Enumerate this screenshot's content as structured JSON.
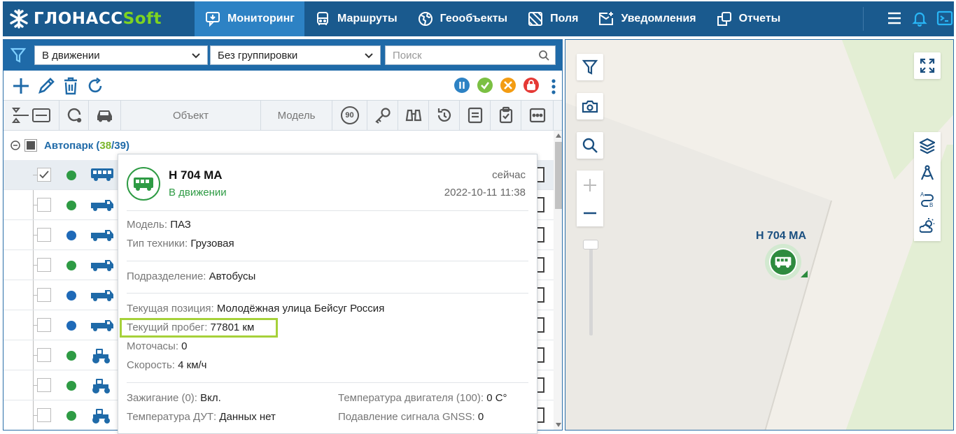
{
  "app": {
    "logo_main": "ГЛОНАСС",
    "logo_accent": "Soft",
    "brand_color": "#1a5a8e",
    "accent_color": "#7ed321"
  },
  "nav": {
    "items": [
      {
        "label": "Мониторинг",
        "icon": "monitor-chat-icon",
        "active": true
      },
      {
        "label": "Маршруты",
        "icon": "bus-front-icon"
      },
      {
        "label": "Геообъекты",
        "icon": "globe-icon"
      },
      {
        "label": "Поля",
        "icon": "field-icon"
      },
      {
        "label": "Уведомления",
        "icon": "mail-icon"
      },
      {
        "label": "Отчеты",
        "icon": "report-icon"
      }
    ],
    "right_icons": [
      "menu-icon",
      "bell-icon",
      "terminal-icon"
    ]
  },
  "filters": {
    "state_select": "В движении",
    "group_select": "Без группировки",
    "search_placeholder": "Поиск"
  },
  "toolbar": {
    "actions": [
      "add-icon",
      "edit-icon",
      "delete-icon",
      "refresh-icon"
    ],
    "status_filters": [
      {
        "icon": "pause-icon",
        "color": "#2d82c4"
      },
      {
        "icon": "check-icon",
        "color": "#7bc043"
      },
      {
        "icon": "tools-icon",
        "color": "#f39c12"
      },
      {
        "icon": "lock-icon",
        "color": "#e53935"
      }
    ]
  },
  "columns": {
    "object": "Объект",
    "model": "Модель",
    "speed_badge": "90"
  },
  "group": {
    "name": "Автопарк",
    "active": "38",
    "total": "39"
  },
  "rows": [
    {
      "selected": true,
      "checked": true,
      "status_color": "#2e9b44",
      "vehicle": "bus"
    },
    {
      "selected": false,
      "checked": false,
      "status_color": "#2e9b44",
      "vehicle": "truck"
    },
    {
      "selected": false,
      "checked": false,
      "status_color": "#1f6ab8",
      "vehicle": "truck"
    },
    {
      "selected": false,
      "checked": false,
      "status_color": "#2e9b44",
      "vehicle": "truck"
    },
    {
      "selected": false,
      "checked": false,
      "status_color": "#1f6ab8",
      "vehicle": "truck"
    },
    {
      "selected": false,
      "checked": false,
      "status_color": "#1f6ab8",
      "vehicle": "truck"
    },
    {
      "selected": false,
      "checked": false,
      "status_color": "#2e9b44",
      "vehicle": "tractor"
    },
    {
      "selected": false,
      "checked": false,
      "status_color": "#2e9b44",
      "vehicle": "tractor"
    },
    {
      "selected": false,
      "checked": false,
      "status_color": "#2e9b44",
      "vehicle": "tractor"
    }
  ],
  "popup": {
    "name": "Н 704 МА",
    "status": "В движении",
    "time_rel": "сейчас",
    "timestamp": "2022-10-11 11:38",
    "model_k": "Модель:",
    "model_v": "ПАЗ",
    "type_k": "Тип техники:",
    "type_v": "Грузовая",
    "dept_k": "Подразделение:",
    "dept_v": "Автобусы",
    "pos_k": "Текущая позиция:",
    "pos_v": "Молодёжная улица Бейсуг Россия",
    "mileage_k": "Текущий пробег:",
    "mileage_v": "77801 км",
    "moto_k": "Моточасы:",
    "moto_v": "0",
    "speed_k": "Скорость:",
    "speed_v": "4 км/ч",
    "ign_k": "Зажигание (0):",
    "ign_v": "Вкл.",
    "dut_k": "Температура ДУТ:",
    "dut_v": "Данных нет",
    "eng_k": "Температура двигателя (100):",
    "eng_v": "0 С°",
    "gnss_k": "Подавление сигнала GNSS:",
    "gnss_v": "0"
  },
  "map": {
    "marker_label": "Н 704 МА",
    "left_tools": [
      "filter-icon",
      "camera-icon",
      "search-icon"
    ],
    "right_tools": [
      "layers-icon",
      "compass-icon",
      "route-icon",
      "weather-icon"
    ]
  }
}
